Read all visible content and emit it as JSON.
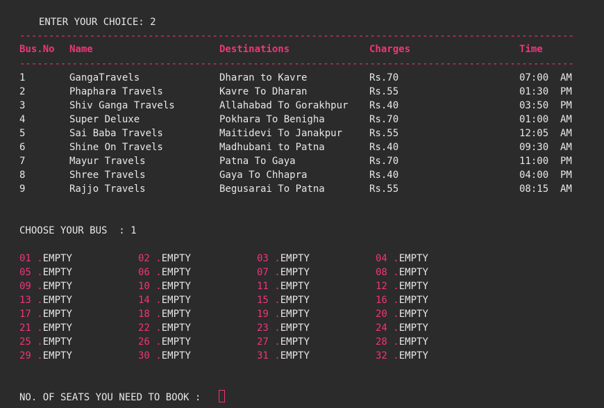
{
  "prompt_choice": "ENTER YOUR CHOICE: 2",
  "separator": "---------------------------------------------------------------------------------------------------------------",
  "table": {
    "headers": [
      "Bus.No",
      "Name",
      "Destinations",
      "Charges",
      "Time"
    ],
    "rows": [
      [
        "1",
        "GangaTravels",
        "Dharan to Kavre",
        "Rs.70",
        "07:00  AM"
      ],
      [
        "2",
        "Phaphara Travels",
        "Kavre To Dharan",
        "Rs.55",
        "01:30  PM"
      ],
      [
        "3",
        "Shiv Ganga Travels",
        "Allahabad To Gorakhpur",
        "Rs.40",
        "03:50  PM"
      ],
      [
        "4",
        "Super Deluxe",
        "Pokhara To Benigha",
        "Rs.70",
        "01:00  AM"
      ],
      [
        "5",
        "Sai Baba Travels",
        "Maitidevi To Janakpur",
        "Rs.55",
        "12:05  AM"
      ],
      [
        "6",
        "Shine On Travels",
        "Madhubani to Patna",
        "Rs.40",
        "09:30  AM"
      ],
      [
        "7",
        "Mayur Travels",
        "Patna To Gaya",
        "Rs.70",
        "11:00  PM"
      ],
      [
        "8",
        "Shree Travels",
        "Gaya To Chhapra",
        "Rs.40",
        "04:00  PM"
      ],
      [
        "9",
        "Rajjo Travels",
        "Begusarai To Patna",
        "Rs.55",
        "08:15  AM"
      ]
    ]
  },
  "prompt_bus": "CHOOSE YOUR BUS  : 1",
  "seats": [
    {
      "num": "01",
      "status": "EMPTY"
    },
    {
      "num": "02",
      "status": "EMPTY"
    },
    {
      "num": "03",
      "status": "EMPTY"
    },
    {
      "num": "04",
      "status": "EMPTY"
    },
    {
      "num": "05",
      "status": "EMPTY"
    },
    {
      "num": "06",
      "status": "EMPTY"
    },
    {
      "num": "07",
      "status": "EMPTY"
    },
    {
      "num": "08",
      "status": "EMPTY"
    },
    {
      "num": "09",
      "status": "EMPTY"
    },
    {
      "num": "10",
      "status": "EMPTY"
    },
    {
      "num": "11",
      "status": "EMPTY"
    },
    {
      "num": "12",
      "status": "EMPTY"
    },
    {
      "num": "13",
      "status": "EMPTY"
    },
    {
      "num": "14",
      "status": "EMPTY"
    },
    {
      "num": "15",
      "status": "EMPTY"
    },
    {
      "num": "16",
      "status": "EMPTY"
    },
    {
      "num": "17",
      "status": "EMPTY"
    },
    {
      "num": "18",
      "status": "EMPTY"
    },
    {
      "num": "19",
      "status": "EMPTY"
    },
    {
      "num": "20",
      "status": "EMPTY"
    },
    {
      "num": "21",
      "status": "EMPTY"
    },
    {
      "num": "22",
      "status": "EMPTY"
    },
    {
      "num": "23",
      "status": "EMPTY"
    },
    {
      "num": "24",
      "status": "EMPTY"
    },
    {
      "num": "25",
      "status": "EMPTY"
    },
    {
      "num": "26",
      "status": "EMPTY"
    },
    {
      "num": "27",
      "status": "EMPTY"
    },
    {
      "num": "28",
      "status": "EMPTY"
    },
    {
      "num": "29",
      "status": "EMPTY"
    },
    {
      "num": "30",
      "status": "EMPTY"
    },
    {
      "num": "31",
      "status": "EMPTY"
    },
    {
      "num": "32",
      "status": "EMPTY"
    }
  ],
  "seat_dot": ".",
  "prompt_seats": "NO. OF SEATS YOU NEED TO BOOK :",
  "colors": {
    "background": "#2b2b2b",
    "text": "#e8e8e8",
    "accent": "#f0357a"
  }
}
